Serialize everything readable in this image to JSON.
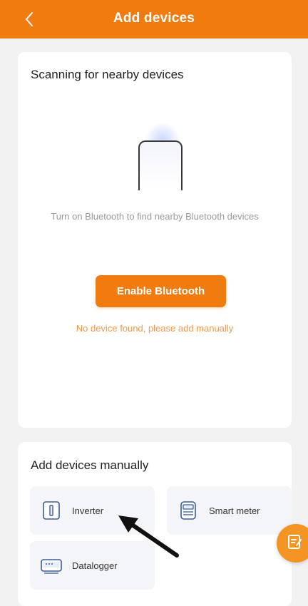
{
  "header": {
    "title": "Add devices",
    "back_icon": "chevron-left-icon",
    "bg_color": "#f07c0f"
  },
  "scan": {
    "title": "Scanning for nearby devices",
    "illustration_icon": "phone-scan-icon",
    "hint": "Turn on Bluetooth to find nearby Bluetooth devices",
    "enable_button": "Enable Bluetooth",
    "no_device_text": "No device found, please add manually"
  },
  "manual": {
    "title": "Add devices manually",
    "devices": [
      {
        "label": "Inverter",
        "icon": "inverter-icon"
      },
      {
        "label": "Smart meter",
        "icon": "smart-meter-icon"
      },
      {
        "label": "Datalogger",
        "icon": "datalogger-icon"
      }
    ]
  },
  "fab": {
    "icon": "edit-note-icon",
    "color": "#f39423"
  },
  "annotation": {
    "icon": "arrow-pointer-icon"
  }
}
